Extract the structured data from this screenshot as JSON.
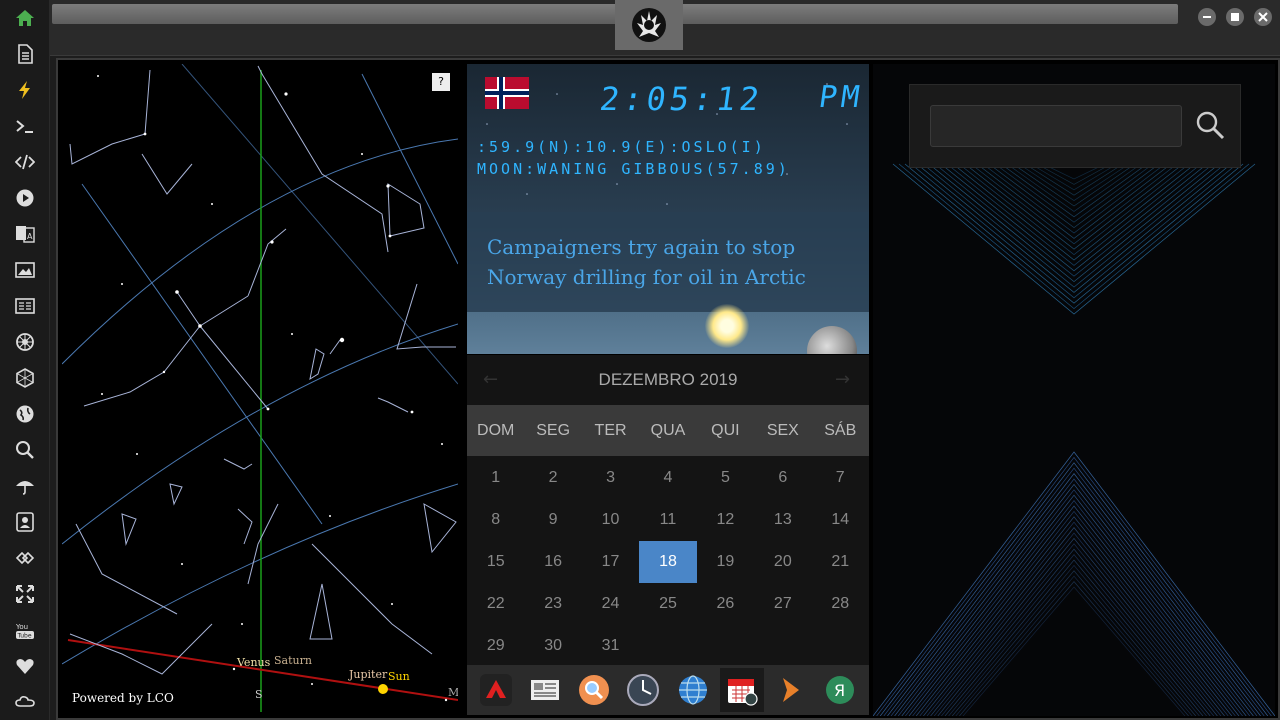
{
  "clock": {
    "time": "2:05:12",
    "ampm": "PM",
    "location": ":59.9(N):10.9(E):OSLO(I)",
    "moon": "MOON:WANING GIBBOUS(57.89)"
  },
  "news": {
    "headline": "Campaigners try again to stop Norway drilling for oil in Arctic"
  },
  "sky": {
    "help_label": "?",
    "powered_by": "Powered by LCO",
    "planet_labels": [
      "Venus",
      "Saturn",
      "Jupiter",
      "Sun"
    ],
    "direction_label": "S",
    "edge_label": "M"
  },
  "calendar": {
    "month_label": "DEZEMBRO 2019",
    "weekdays": [
      "DOM",
      "SEG",
      "TER",
      "QUA",
      "QUI",
      "SEX",
      "SÁB"
    ],
    "weeks": [
      [
        "1",
        "2",
        "3",
        "4",
        "5",
        "6",
        "7"
      ],
      [
        "8",
        "9",
        "10",
        "11",
        "12",
        "13",
        "14"
      ],
      [
        "15",
        "16",
        "17",
        "18",
        "19",
        "20",
        "21"
      ],
      [
        "22",
        "23",
        "24",
        "25",
        "26",
        "27",
        "28"
      ],
      [
        "29",
        "30",
        "31",
        "",
        "",
        "",
        ""
      ]
    ],
    "today": "18"
  },
  "search": {
    "value": ""
  },
  "colors": {
    "accent_blue": "#2fb5ff",
    "today_bg": "#4a86c8",
    "home_green": "#4caf50",
    "bolt_yellow": "#f0c020"
  },
  "rail_icons": [
    "home-icon",
    "document-icon",
    "bolt-icon",
    "terminal-icon",
    "code-icon",
    "play-icon",
    "translate-icon",
    "image-icon",
    "news-icon",
    "rebel-icon",
    "hexagon-icon",
    "globe-icon",
    "search-icon",
    "umbrella-icon",
    "contact-icon",
    "link-icon",
    "expand-icon",
    "youtube-icon",
    "heart-icon",
    "cloud-icon"
  ],
  "dock_icons": [
    "autodesk-icon",
    "newspaper-icon",
    "magnifier-icon",
    "clock-icon",
    "globe-icon",
    "calendar-icon",
    "arrow-icon",
    "yandex-icon"
  ]
}
